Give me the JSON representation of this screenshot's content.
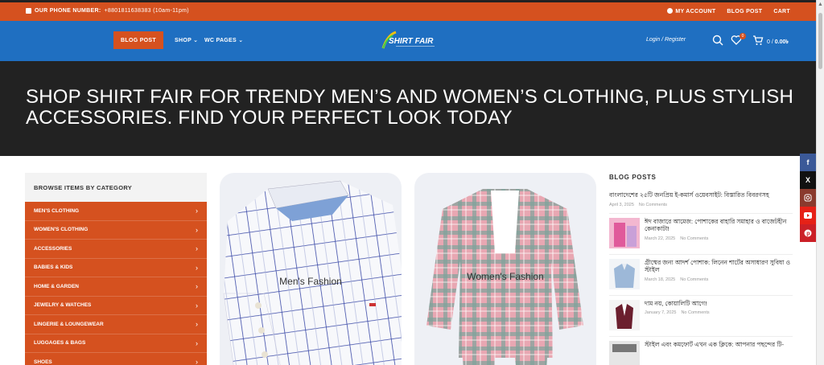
{
  "topbar": {
    "phone_label": "OUR PHONE NUMBER:",
    "phone_number": "+8801811638383 (10am-11pm)",
    "links": [
      "MY ACCOUNT",
      "BLOG POST",
      "CART"
    ]
  },
  "header": {
    "blog_button": "BLOG POST",
    "nav": [
      "SHOP",
      "WC PAGES"
    ],
    "logo_text": "SHIRT FAIR",
    "login": "Login / Register",
    "wishlist_count": "0",
    "cart_count": "0",
    "cart_total": "0.00৳"
  },
  "hero": {
    "title": "SHOP SHIRT FAIR FOR TRENDY MEN’S AND WOMEN’S CLOTHING, PLUS STYLISH ACCESSORIES. FIND YOUR PERFECT LOOK TODAY"
  },
  "categories": {
    "heading": "BROWSE ITEMS BY CATEGORY",
    "items": [
      "MEN'S CLOTHING",
      "WOMEN'S CLOTHING",
      "ACCESSORIES",
      "BABIES & KIDS",
      "HOME & GARDEN",
      "JEWELRY & WATCHES",
      "LINGERIE & LOUNGEWEAR",
      "LUGGAGES & BAGS",
      "SHOES"
    ]
  },
  "products": {
    "mens": "Men's Fashion",
    "womens": "Women's Fashion"
  },
  "blog": {
    "heading": "BLOG POSTS",
    "no_comments": "No Comments",
    "posts": [
      {
        "title": "বাংলাদেশের ২৫টি জনপ্রিয় ই-কমার্স ওয়েবসাইট: বিস্তারিত বিবরণসহ",
        "date": "April 3, 2025"
      },
      {
        "title": "ঈদ বাজারে আমেজ: পোশাকের বাহারি সমাহার ও বাজেটহীন কেনাকাটা!",
        "date": "March 22, 2025"
      },
      {
        "title": "গ্রীষ্মের জন্য আদর্শ পোশাক: লিনেন শার্টের অসাধারণ সুবিধা ও স্টাইল",
        "date": "March 18, 2025"
      },
      {
        "title": "দাম নয়, কোয়ালিটি আগে!",
        "date": "January 7, 2025"
      },
      {
        "title": "স্টাইল এবং কমফোর্ট এখন এক ক্লিকে: আপনার পছন্দের টি-",
        "date": ""
      }
    ]
  },
  "colors": {
    "accent": "#d5511f",
    "header_blue": "#1f6fc1",
    "hero_bg": "#222222"
  },
  "social": [
    "facebook-icon",
    "x-icon",
    "instagram-icon",
    "youtube-icon",
    "pinterest-icon"
  ]
}
